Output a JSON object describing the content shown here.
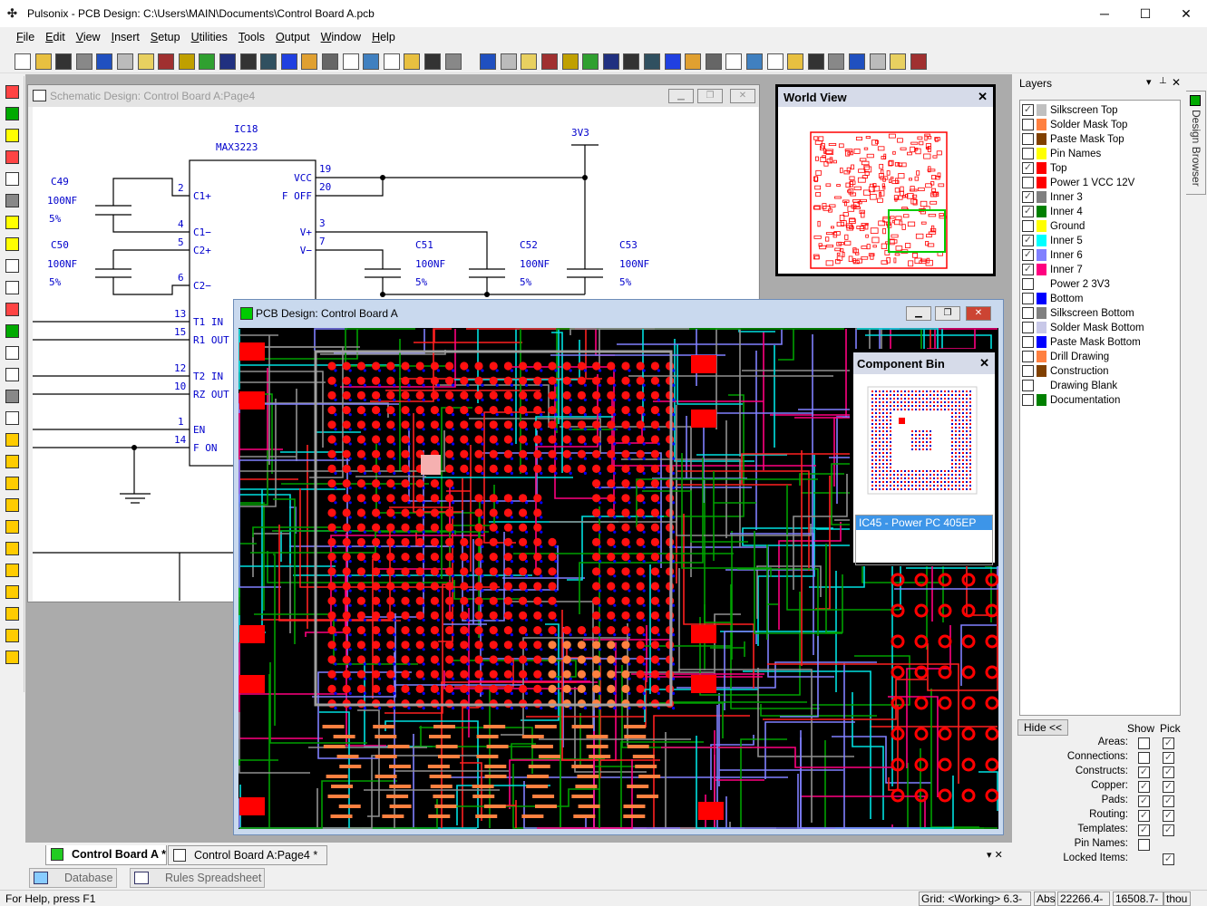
{
  "app": {
    "title": "Pulsonix - PCB Design: C:\\Users\\MAIN\\Documents\\Control Board A.pcb",
    "minimize": "─",
    "maximize": "☐",
    "close": "✕"
  },
  "menu": [
    "File",
    "Edit",
    "View",
    "Insert",
    "Setup",
    "Utilities",
    "Tools",
    "Output",
    "Window",
    "Help"
  ],
  "toolbar_icons": [
    "new-icon",
    "open-icon",
    "save-icon",
    "print-icon",
    "undo-icon",
    "redo-icon",
    "folder-icon",
    "library-icon",
    "component-icon",
    "route-icon",
    "design-rules-icon",
    "copper-pour-icon",
    "plane-icon",
    "wizard-icon",
    "palette-icon",
    "windows-icon",
    "report-icon",
    "zoom-all-icon",
    "zoom-previous-icon",
    "zoom-area-icon",
    "zoom-in-icon",
    "zoom-out-icon",
    "select-mode-icon",
    "pick-icon",
    "measure-icon",
    "grid-icon",
    "align-icon",
    "bom-icon",
    "binoculars-icon",
    "filter-icon",
    "layer-icon",
    "cross-probe-icon",
    "drc-icon",
    "pointer-icon",
    "select-icon",
    "swap-icon",
    "text-icon",
    "calculator-icon",
    "pad-icon",
    "move-icon",
    "lock-icon",
    "unlock-icon",
    "toggle-icon",
    "padlock-icon"
  ],
  "left_icons": [
    "select-area-icon",
    "place-component-icon",
    "add-shape-icon",
    "add-rect-icon",
    "add-circle-icon",
    "add-polygon-icon",
    "add-template-icon",
    "add-area-icon",
    "add-line-icon",
    "add-track-icon",
    "add-arc-icon",
    "add-via-icon",
    "add-text-icon",
    "add-testpoint-icon",
    "add-dimension-icon",
    "add-board-icon",
    "interactive-route-icon",
    "auto-route-icon",
    "push-route-icon",
    "fanout-icon",
    "gloss-icon",
    "lock-layer-icon",
    "lock-1-icon",
    "lock-2-icon",
    "lock-3-icon",
    "lock-4-icon",
    "lock-5-icon"
  ],
  "schematic": {
    "title": "Schematic Design: Control Board A:Page4",
    "ic_ref": "IC18",
    "ic_name": "MAX3223",
    "net_3v3": "3V3",
    "pins_left": [
      {
        "num": "2",
        "name": "C1+"
      },
      {
        "num": "4",
        "name": "C1−"
      },
      {
        "num": "5",
        "name": "C2+"
      },
      {
        "num": "6",
        "name": "C2−"
      },
      {
        "num": "13",
        "name": "T1 IN"
      },
      {
        "num": "15",
        "name": "R1 OUT"
      },
      {
        "num": "12",
        "name": "T2 IN"
      },
      {
        "num": "10",
        "name": "RZ OUT"
      },
      {
        "num": "1",
        "name": "EN"
      },
      {
        "num": "14",
        "name": "F ON"
      }
    ],
    "pins_right": [
      {
        "num": "19",
        "name": "VCC"
      },
      {
        "num": "20",
        "name": "F OFF"
      },
      {
        "num": "3",
        "name": "V+"
      },
      {
        "num": "7",
        "name": "V−"
      }
    ],
    "caps": [
      {
        "ref": "C49",
        "value": "100NF",
        "tol": "5%"
      },
      {
        "ref": "C50",
        "value": "100NF",
        "tol": "5%"
      },
      {
        "ref": "C51",
        "value": "100NF",
        "tol": "5%"
      },
      {
        "ref": "C52",
        "value": "100NF",
        "tol": "5%"
      },
      {
        "ref": "C53",
        "value": "100NF",
        "tol": "5%"
      }
    ]
  },
  "world_view": {
    "title": "World View",
    "close": "✕"
  },
  "pcb": {
    "title": "PCB Design: Control Board A"
  },
  "component_bin": {
    "title": "Component Bin",
    "close": "✕",
    "selected": "IC45 - Power PC 405EP"
  },
  "layers": {
    "title": "Layers",
    "menu": "▾",
    "pin": "📌",
    "close": "✕",
    "side_tab": "Design Browser",
    "items": [
      {
        "name": "Silkscreen Top",
        "color": "#c0c0c0",
        "checked": true
      },
      {
        "name": "Solder Mask Top",
        "color": "#ff8040",
        "checked": false
      },
      {
        "name": "Paste Mask Top",
        "color": "#804000",
        "checked": false
      },
      {
        "name": "Pin Names",
        "color": "#ffff00",
        "checked": false
      },
      {
        "name": "Top",
        "color": "#ff0000",
        "checked": true
      },
      {
        "name": "Power 1 VCC 12V",
        "color": "#ff0000",
        "checked": false
      },
      {
        "name": "Inner 3",
        "color": "#808080",
        "checked": true
      },
      {
        "name": "Inner 4",
        "color": "#008000",
        "checked": true
      },
      {
        "name": "Ground",
        "color": "#ffff00",
        "checked": false
      },
      {
        "name": "Inner 5",
        "color": "#00ffff",
        "checked": true
      },
      {
        "name": "Inner 6",
        "color": "#8080ff",
        "checked": true
      },
      {
        "name": "Inner 7",
        "color": "#ff0080",
        "checked": true
      },
      {
        "name": "Power 2 3V3",
        "color": "",
        "checked": false
      },
      {
        "name": "Bottom",
        "color": "#0000ff",
        "checked": false
      },
      {
        "name": "Silkscreen Bottom",
        "color": "#808080",
        "checked": false
      },
      {
        "name": "Solder Mask Bottom",
        "color": "#c8c8e8",
        "checked": false
      },
      {
        "name": "Paste Mask Bottom",
        "color": "#0000ff",
        "checked": false
      },
      {
        "name": "Drill Drawing",
        "color": "#ff8040",
        "checked": false
      },
      {
        "name": "Construction",
        "color": "#804000",
        "checked": false
      },
      {
        "name": "Drawing Blank",
        "color": "",
        "checked": false
      },
      {
        "name": "Documentation",
        "color": "#008000",
        "checked": false
      }
    ],
    "hide_button": "Hide <<",
    "show_label": "Show",
    "pick_label": "Pick",
    "options": [
      {
        "label": "Areas:",
        "show": false,
        "pick": true
      },
      {
        "label": "Connections:",
        "show": false,
        "pick": true
      },
      {
        "label": "Constructs:",
        "show": true,
        "pick": true
      },
      {
        "label": "Copper:",
        "show": true,
        "pick": true
      },
      {
        "label": "Pads:",
        "show": true,
        "pick": true
      },
      {
        "label": "Routing:",
        "show": true,
        "pick": true
      },
      {
        "label": "Templates:",
        "show": true,
        "pick": true
      },
      {
        "label": "Pin Names:",
        "show": false,
        "pick": null
      },
      {
        "label": "Locked Items:",
        "show": null,
        "pick": true
      }
    ]
  },
  "doc_tabs": [
    {
      "label": "Control Board A *",
      "active": true
    },
    {
      "label": "Control Board A:Page4 *",
      "active": false
    }
  ],
  "bottom_tabs": [
    "Database",
    "Rules Spreadsheet"
  ],
  "status": {
    "help": "For Help, press F1",
    "grid": "Grid: <Working> 6.3-",
    "mode": "Abs",
    "x": "22266.4-",
    "y": "16508.7-",
    "units": "thou"
  }
}
